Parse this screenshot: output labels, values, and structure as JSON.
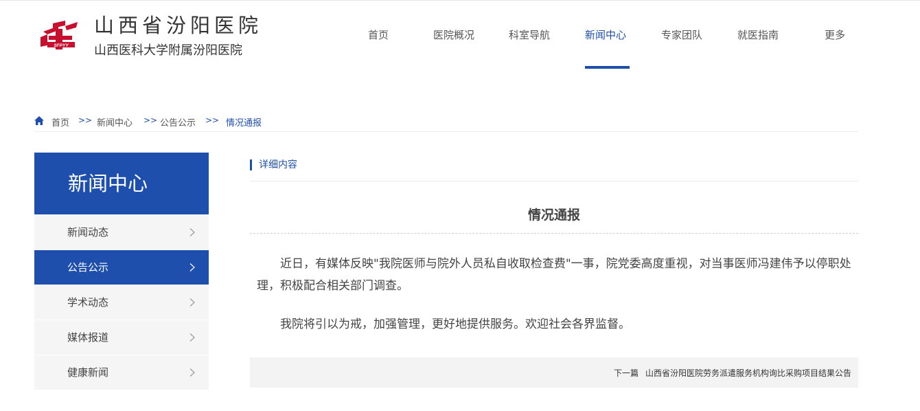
{
  "header": {
    "logo_text": "SFPYY",
    "title": "山西省汾阳医院",
    "subtitle": "山西医科大学附属汾阳医院"
  },
  "nav": {
    "items": [
      {
        "label": "首页"
      },
      {
        "label": "医院概况"
      },
      {
        "label": "科室导航"
      },
      {
        "label": "新闻中心",
        "active": true
      },
      {
        "label": "专家团队"
      },
      {
        "label": "就医指南"
      },
      {
        "label": "更多"
      }
    ]
  },
  "breadcrumb": {
    "home_icon": "home-icon",
    "items": [
      "首页",
      "新闻中心",
      "公告公示",
      "情况通报"
    ],
    "separator": ">>"
  },
  "sidebar": {
    "title": "新闻中心",
    "items": [
      {
        "label": "新闻动态"
      },
      {
        "label": "公告公示",
        "active": true
      },
      {
        "label": "学术动态"
      },
      {
        "label": "媒体报道"
      },
      {
        "label": "健康新闻"
      }
    ]
  },
  "main": {
    "section_label": "详细内容",
    "article_title": "情况通报",
    "paragraphs": [
      "近日，有媒体反映\"我院医师与院外人员私自收取检查费\"一事，院党委高度重视，对当事医师冯建伟予以停职处理，积极配合相关部门调查。",
      "我院将引以为戒，加强管理，更好地提供服务。欢迎社会各界监督。"
    ],
    "next_label": "下一篇",
    "next_title": "山西省汾阳医院劳务派遣服务机构询比采购项目结果公告"
  },
  "colors": {
    "accent": "#1e4fad",
    "logo_red": "#c8102e",
    "sidebar_bg": "#f5f5f5",
    "text": "#333333"
  }
}
